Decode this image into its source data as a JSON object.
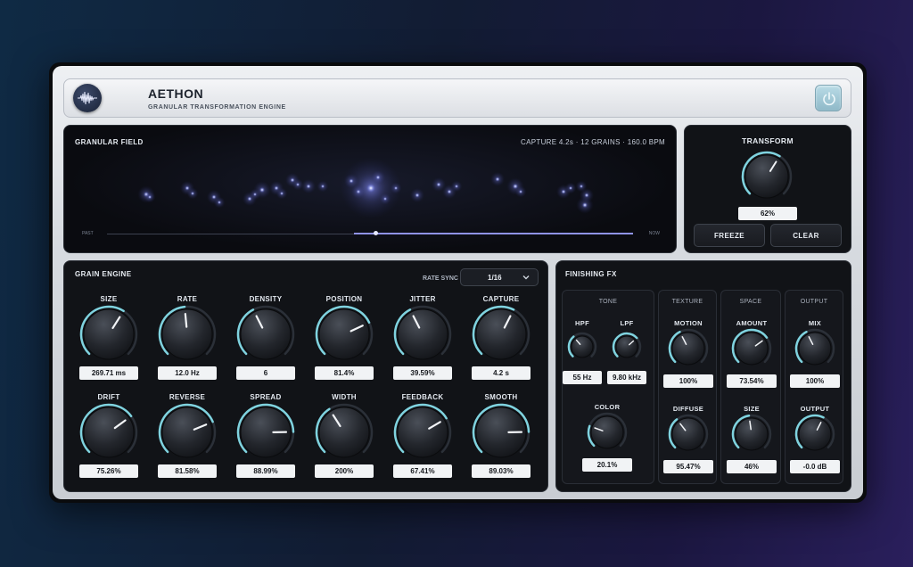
{
  "app": {
    "title": "AETHON",
    "subtitle": "GRANULAR TRANSFORMATION ENGINE",
    "logo_icon": "waveform-icon",
    "power_icon": "power-icon",
    "accent": "#7fd3df"
  },
  "field": {
    "title": "GRANULAR FIELD",
    "info": "CAPTURE 4.2s  ·  12 GRAINS  ·  160.0 BPM",
    "past_label": "PAST",
    "now_label": "NOW",
    "playhead": 0.36
  },
  "transform": {
    "title": "TRANSFORM",
    "value": "62%",
    "amount": 0.62,
    "freeze_label": "FREEZE",
    "clear_label": "CLEAR"
  },
  "grain_engine": {
    "title": "GRAIN ENGINE",
    "rate_sync_label": "RATE SYNC",
    "rate_sync_value": "1/16",
    "knobs": [
      {
        "label": "SIZE",
        "value": "269.71 ms",
        "norm": 0.62
      },
      {
        "label": "RATE",
        "value": "12.0 Hz",
        "norm": 0.48
      },
      {
        "label": "DENSITY",
        "value": "6",
        "norm": 0.4
      },
      {
        "label": "POSITION",
        "value": "81.4%",
        "norm": 0.74
      },
      {
        "label": "JITTER",
        "value": "39.59%",
        "norm": 0.4
      },
      {
        "label": "CAPTURE",
        "value": "4.2 s",
        "norm": 0.6
      },
      {
        "label": "DRIFT",
        "value": "75.26%",
        "norm": 0.7
      },
      {
        "label": "REVERSE",
        "value": "81.58%",
        "norm": 0.75
      },
      {
        "label": "SPREAD",
        "value": "88.99%",
        "norm": 0.83
      },
      {
        "label": "WIDTH",
        "value": "200%",
        "norm": 0.38
      },
      {
        "label": "FEEDBACK",
        "value": "67.41%",
        "norm": 0.72
      },
      {
        "label": "SMOOTH",
        "value": "89.03%",
        "norm": 0.83
      }
    ]
  },
  "finishing_fx": {
    "title": "FINISHING FX",
    "sections": [
      {
        "title": "TONE",
        "knobs": [
          {
            "label": "HPF",
            "value": "55 Hz",
            "norm": 0.35
          },
          {
            "label": "LPF",
            "value": "9.80 kHz",
            "norm": 0.68
          },
          {
            "label": "COLOR",
            "value": "20.1%",
            "norm": 0.24
          }
        ]
      },
      {
        "title": "TEXTURE",
        "knobs": [
          {
            "label": "MOTION",
            "value": "100%",
            "norm": 0.4
          },
          {
            "label": "DIFFUSE",
            "value": "95.47%",
            "norm": 0.36
          }
        ]
      },
      {
        "title": "SPACE",
        "knobs": [
          {
            "label": "AMOUNT",
            "value": "73.54%",
            "norm": 0.7
          },
          {
            "label": "SIZE",
            "value": "46%",
            "norm": 0.47
          }
        ]
      },
      {
        "title": "OUTPUT",
        "knobs": [
          {
            "label": "MIX",
            "value": "100%",
            "norm": 0.4
          },
          {
            "label": "OUTPUT",
            "value": "-0.0 dB",
            "norm": 0.6
          }
        ]
      }
    ]
  }
}
